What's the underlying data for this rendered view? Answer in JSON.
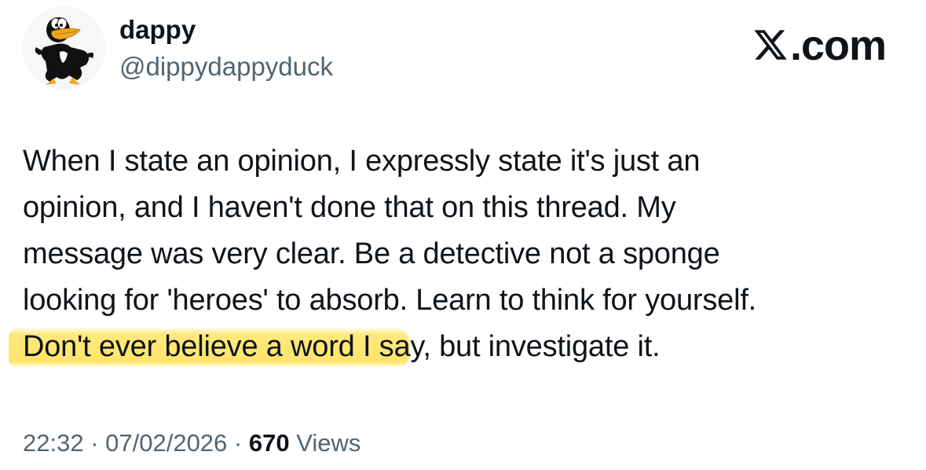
{
  "author": {
    "display_name": "dappy",
    "handle": "@dippydappyduck"
  },
  "brand": {
    "text": ".com"
  },
  "tweet": {
    "lines": [
      "When I state an opinion, I expressly state it's just an",
      "opinion, and I haven't done that on this thread. My",
      "message was very clear. Be a detective not a sponge",
      "looking for 'heroes' to absorb. Learn to think for yourself."
    ],
    "highlighted_text": "Don't ever believe a word I sa",
    "trailing_text": "y, but investigate it."
  },
  "meta": {
    "time": "22:32",
    "separator_1": " · ",
    "date": "07/02/2026",
    "separator_2": " · ",
    "views_count": "670",
    "views_label": " Views"
  },
  "colors": {
    "text_primary": "#0f1419",
    "text_secondary": "#536471",
    "highlight": "#ffe25c"
  },
  "icons": {
    "avatar": "cartoon-duck-avatar",
    "brand": "x-logo-icon"
  }
}
